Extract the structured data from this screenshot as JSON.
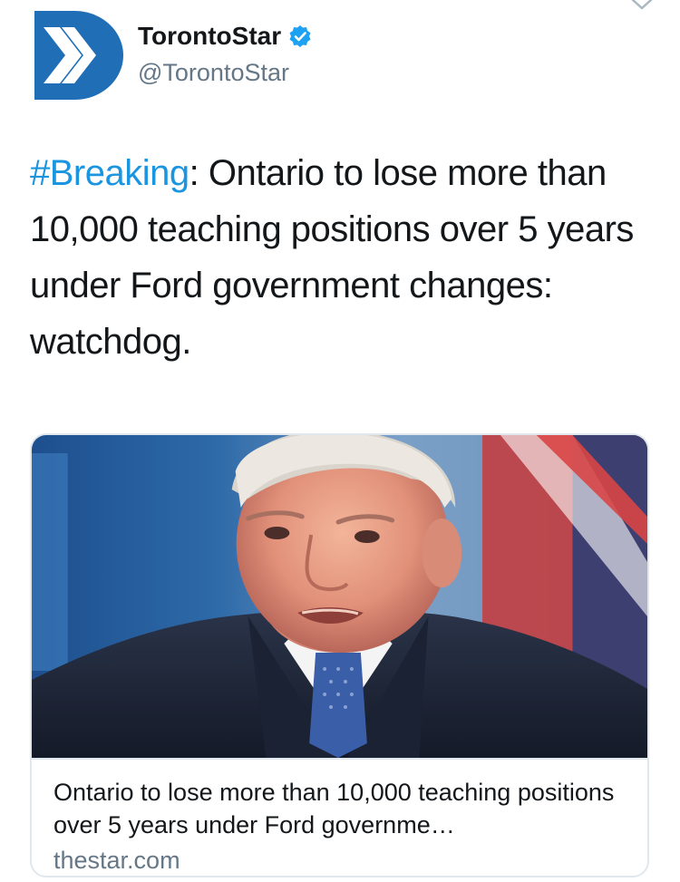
{
  "tweet": {
    "display_name": "TorontoStar",
    "handle": "@TorontoStar",
    "hashtag": "#Breaking",
    "text_after_hashtag": ": Ontario to lose more than 10,000 teaching positions over 5 years under Ford government changes: watchdog."
  },
  "card": {
    "title": "Ontario to lose more than 10,000 teaching positions over 5 years under Ford governme…",
    "domain": "thestar.com",
    "image_icon": "news-photo"
  },
  "colors": {
    "brand_blue": "#1f6eb6",
    "link_blue": "#1b95e0",
    "verified_blue": "#1da1f2",
    "muted_gray": "#657786"
  },
  "icons": {
    "avatar": "toronto-star-chevron-logo",
    "verified": "verified-badge-icon",
    "menu": "chevron-down-icon"
  }
}
